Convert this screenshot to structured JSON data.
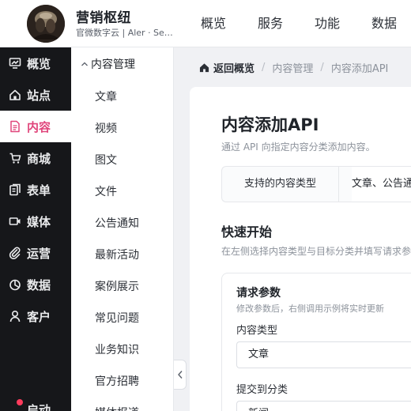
{
  "header": {
    "brand_title": "营销枢纽",
    "brand_subtitle": "官微数字云 | Aler · Se…",
    "nav": [
      {
        "label": "概览"
      },
      {
        "label": "服务"
      },
      {
        "label": "功能"
      },
      {
        "label": "数据"
      }
    ]
  },
  "sidebar": {
    "items": [
      {
        "label": "概览",
        "icon": "dashboard-icon"
      },
      {
        "label": "站点",
        "icon": "home-icon"
      },
      {
        "label": "内容",
        "icon": "document-icon",
        "active": true
      },
      {
        "label": "商城",
        "icon": "cart-icon"
      },
      {
        "label": "表单",
        "icon": "form-icon"
      },
      {
        "label": "媒体",
        "icon": "video-icon"
      },
      {
        "label": "运营",
        "icon": "paperclip-icon"
      },
      {
        "label": "数据",
        "icon": "pie-chart-icon"
      },
      {
        "label": "客户",
        "icon": "user-icon"
      }
    ],
    "bottom_label": "启动"
  },
  "submenu": {
    "group_title": "内容管理",
    "items": [
      {
        "label": "文章"
      },
      {
        "label": "视频"
      },
      {
        "label": "图文"
      },
      {
        "label": "文件"
      },
      {
        "label": "公告通知"
      },
      {
        "label": "最新活动"
      },
      {
        "label": "案例展示"
      },
      {
        "label": "常见问题"
      },
      {
        "label": "业务知识"
      },
      {
        "label": "官方招聘"
      },
      {
        "label": "媒体报道"
      }
    ]
  },
  "breadcrumb": {
    "home": "返回概览",
    "items": [
      "内容管理",
      "内容添加API"
    ],
    "separator": "/"
  },
  "main": {
    "title": "内容添加API",
    "description": "通过 API 向指定内容分类添加内容。",
    "supported_types_label": "支持的内容类型",
    "supported_types_value": "文章、公告通知",
    "quickstart_title": "快速开始",
    "quickstart_desc": "在左侧选择内容类型与目标分类并填写请求参数",
    "params": {
      "title": "请求参数",
      "hint": "修改参数后，右侧调用示例将实时更新",
      "content_type_label": "内容类型",
      "content_type_value": "文章",
      "category_label": "提交到分类",
      "category_value": "新闻"
    }
  },
  "colors": {
    "accent": "#e0457b",
    "sidebar_bg": "#16171a",
    "notification_dot": "#ff3b5c"
  }
}
